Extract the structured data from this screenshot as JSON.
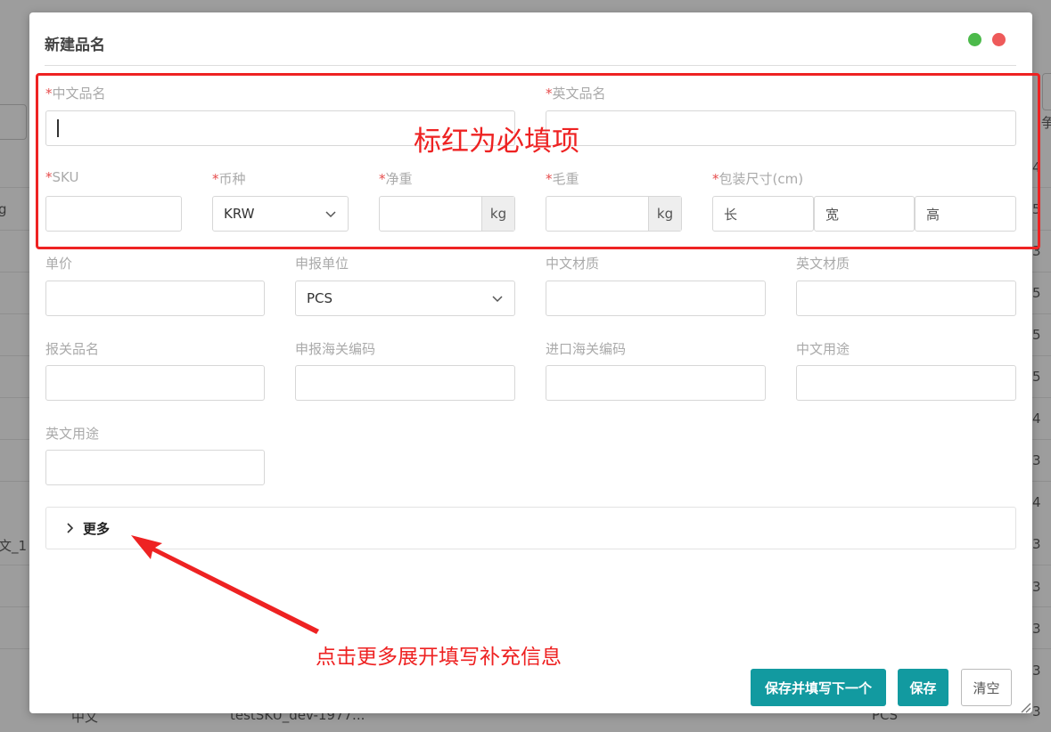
{
  "background": {
    "left_texts": [
      "g",
      "文_1"
    ],
    "right_digits": [
      "4",
      "5",
      "3",
      "5",
      "5",
      "5",
      "4",
      "3",
      "4",
      "3",
      "3",
      "3",
      "3",
      "3"
    ],
    "right_partial": "争",
    "bottom_texts": [
      "中文",
      "testSKU_dev-1977...",
      "PCS"
    ]
  },
  "modal": {
    "title": "新建品名",
    "fields": {
      "cn_name": {
        "label": "中文品名",
        "required": "*",
        "value": ""
      },
      "en_name": {
        "label": "英文品名",
        "required": "*",
        "value": ""
      },
      "sku": {
        "label": "SKU",
        "required": "*",
        "value": ""
      },
      "currency": {
        "label": "币种",
        "required": "*",
        "value": "KRW"
      },
      "net_weight": {
        "label": "净重",
        "required": "*",
        "unit": "kg"
      },
      "gross_weight": {
        "label": "毛重",
        "required": "*",
        "unit": "kg"
      },
      "package_size": {
        "label": "包装尺寸(cm)",
        "required": "*",
        "length": "长",
        "width": "宽",
        "height": "高"
      },
      "unit_price": {
        "label": "单价"
      },
      "declare_unit": {
        "label": "申报单位",
        "value": "PCS"
      },
      "cn_material": {
        "label": "中文材质"
      },
      "en_material": {
        "label": "英文材质"
      },
      "customs_name": {
        "label": "报关品名"
      },
      "declare_hs_code": {
        "label": "申报海关编码"
      },
      "import_hs_code": {
        "label": "进口海关编码"
      },
      "cn_usage": {
        "label": "中文用途"
      },
      "en_usage": {
        "label": "英文用途"
      }
    },
    "more": {
      "label": "更多"
    },
    "buttons": {
      "save_next": "保存并填写下一个",
      "save": "保存",
      "clear": "清空"
    }
  },
  "annotations": {
    "required_note": "标红为必填项",
    "more_note": "点击更多展开填写补充信息"
  },
  "colors": {
    "primary": "#129aa0",
    "annotation_red": "#ee2222",
    "required_star": "#e64c4c",
    "dot_green": "#4cba4b",
    "dot_red": "#ee5a5a"
  }
}
